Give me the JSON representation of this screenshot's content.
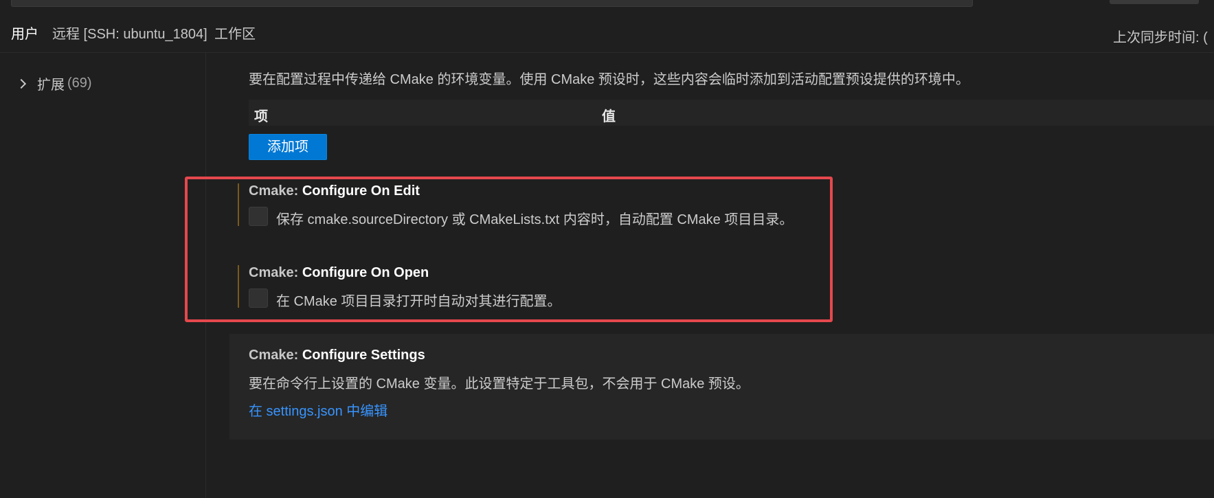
{
  "tabs": {
    "user": "用户",
    "remote": "远程 [SSH: ubuntu_1804]",
    "workspace": "工作区"
  },
  "sync": {
    "label": "上次同步时间: ("
  },
  "tree": {
    "extensions_label": "扩展",
    "extensions_count": "(69)"
  },
  "env_setting": {
    "description": "要在配置过程中传递给 CMake 的环境变量。使用 CMake 预设时，这些内容会临时添加到活动配置预设提供的环境中。",
    "col_item": "项",
    "col_value": "值",
    "add_button": "添加项"
  },
  "configure_on_edit": {
    "category": "Cmake: ",
    "key": "Configure On Edit",
    "description": "保存 cmake.sourceDirectory 或 CMakeLists.txt 内容时，自动配置 CMake 项目目录。",
    "checked": false
  },
  "configure_on_open": {
    "category": "Cmake: ",
    "key": "Configure On Open",
    "description": "在 CMake 项目目录打开时自动对其进行配置。",
    "checked": false
  },
  "configure_settings": {
    "category": "Cmake: ",
    "key": "Configure Settings",
    "description": "要在命令行上设置的 CMake 变量。此设置特定于工具包，不会用于 CMake 预设。",
    "link": "在 settings.json 中编辑"
  },
  "colors": {
    "accent_button": "#0078d4",
    "link": "#3794ff",
    "highlight": "#e5484d",
    "modified_bar": "#7a5a1a"
  }
}
